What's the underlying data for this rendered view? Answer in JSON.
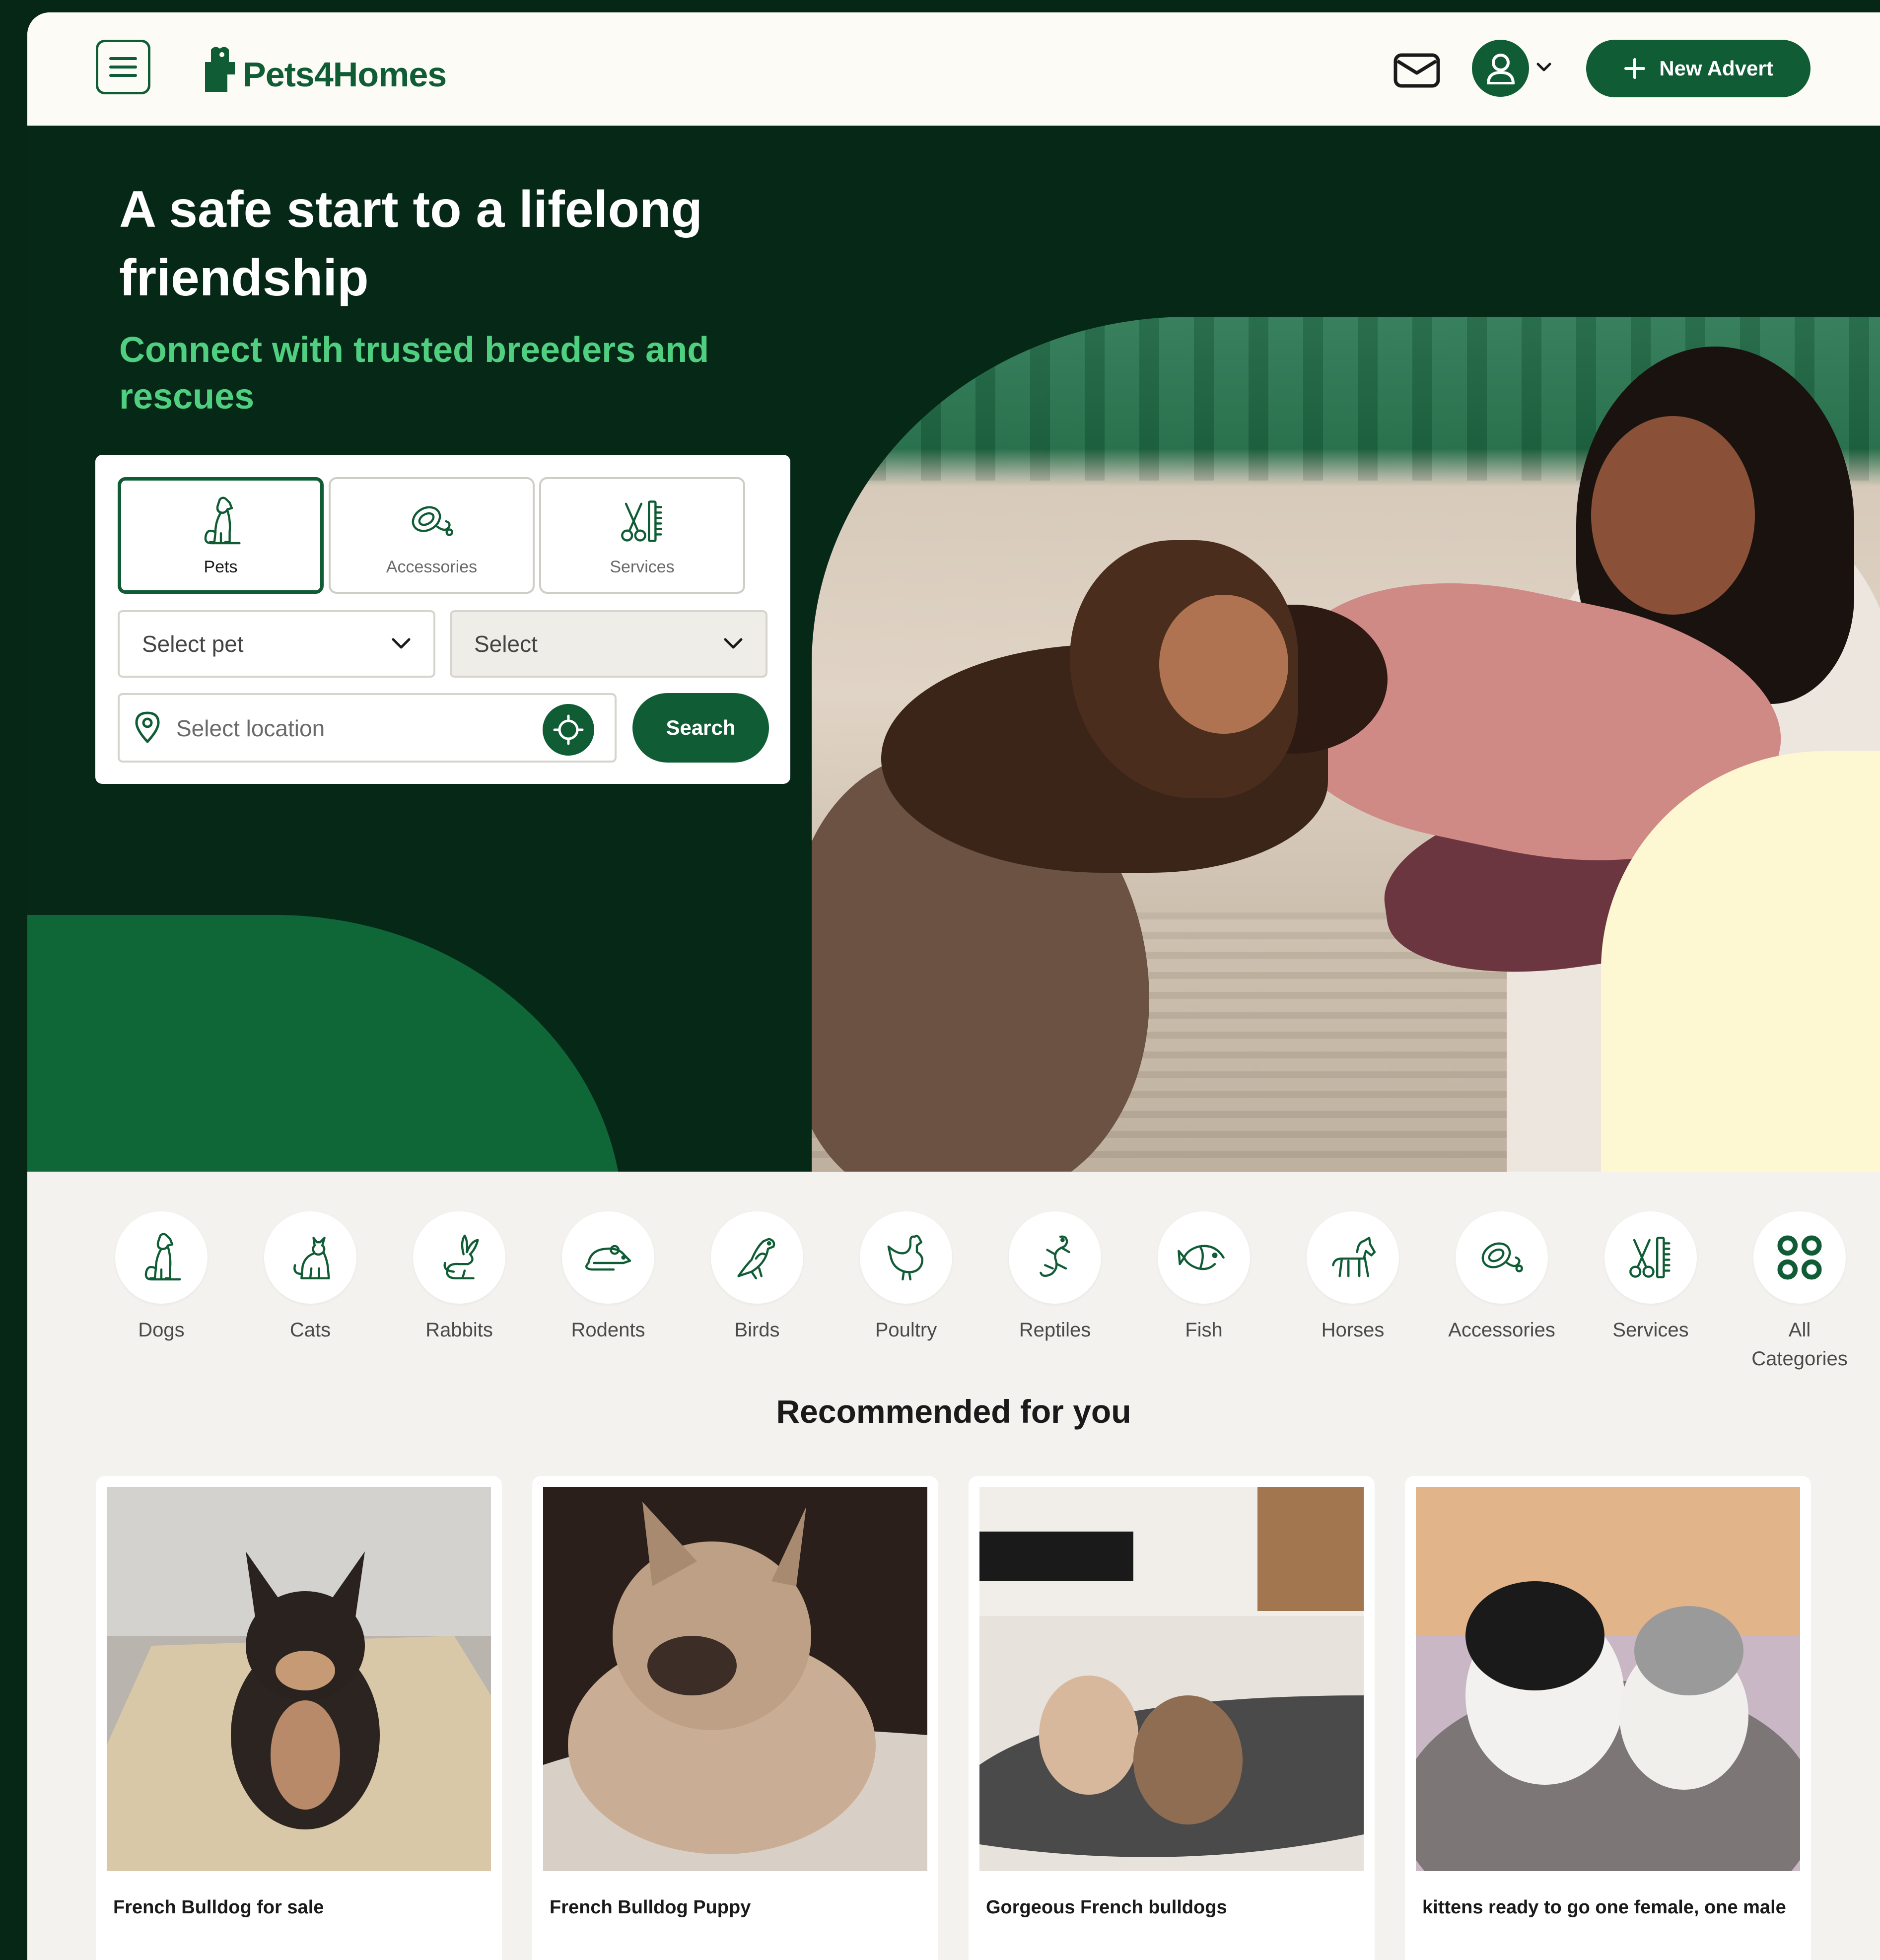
{
  "header": {
    "brand": "Pets4Homes",
    "new_advert_label": "New Advert"
  },
  "hero": {
    "title": "A safe start to a lifelong friendship",
    "subtitle": "Connect with trusted breeders and rescues"
  },
  "search": {
    "tabs": [
      {
        "label": "Pets",
        "icon": "dog-icon",
        "active": true
      },
      {
        "label": "Accessories",
        "icon": "leash-icon",
        "active": false
      },
      {
        "label": "Services",
        "icon": "grooming-icon",
        "active": false
      }
    ],
    "pet_select": "Select pet",
    "second_select": "Select",
    "location_placeholder": "Select location",
    "search_label": "Search"
  },
  "categories": [
    {
      "label": "Dogs",
      "icon": "dog-icon"
    },
    {
      "label": "Cats",
      "icon": "cat-icon"
    },
    {
      "label": "Rabbits",
      "icon": "rabbit-icon"
    },
    {
      "label": "Rodents",
      "icon": "rodent-icon"
    },
    {
      "label": "Birds",
      "icon": "bird-icon"
    },
    {
      "label": "Poultry",
      "icon": "chicken-icon"
    },
    {
      "label": "Reptiles",
      "icon": "lizard-icon"
    },
    {
      "label": "Fish",
      "icon": "fish-icon"
    },
    {
      "label": "Horses",
      "icon": "horse-icon"
    },
    {
      "label": "Accessories",
      "icon": "leash-icon"
    },
    {
      "label": "Services",
      "icon": "grooming-icon"
    },
    {
      "label": "All Categories",
      "icon": "grid-icon"
    }
  ],
  "recommended": {
    "title": "Recommended for you",
    "cards": [
      {
        "title": "French Bulldog for sale"
      },
      {
        "title": "French Bulldog Puppy"
      },
      {
        "title": "Gorgeous French bulldogs"
      },
      {
        "title": "kittens ready to go one female, one male"
      }
    ]
  },
  "colors": {
    "brand_green": "#0f5c35",
    "hero_dark": "#052817",
    "accent_green": "#4fcf7f",
    "cream": "#fdf7d2"
  }
}
